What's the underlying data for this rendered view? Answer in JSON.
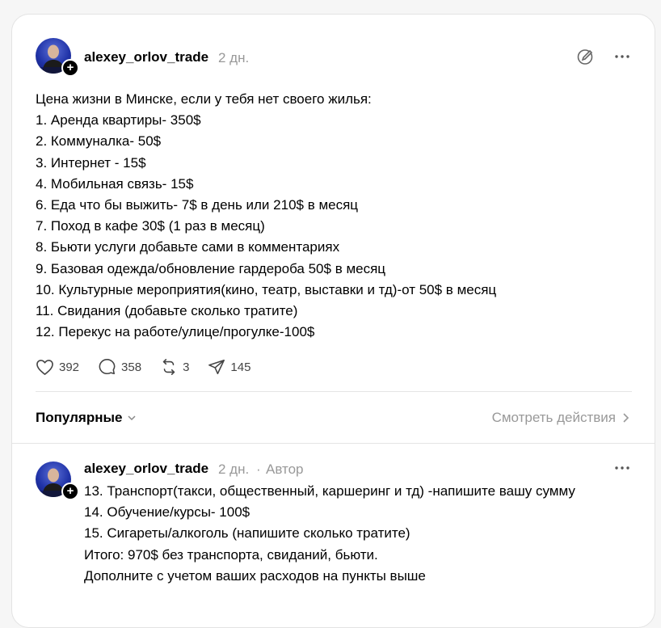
{
  "post": {
    "username": "alexey_orlov_trade",
    "time": "2 дн.",
    "lines": [
      "Цена жизни в Минске, если у тебя нет своего жилья:",
      "1. Аренда квартиры- 350$",
      "2. Коммуналка- 50$",
      "3. Интернет - 15$",
      "4. Мобильная связь- 15$",
      "6. Еда что бы выжить- 7$ в день или 210$ в месяц",
      "7. Поход в кафе 30$ (1 раз в месяц)",
      "8. Бьюти услуги добавьте сами в комментариях",
      "9. Базовая одежда/обновление гардероба 50$ в месяц",
      "10. Культурные мероприятия(кино, театр, выставки и тд)-от 50$ в месяц",
      "11. Свидания (добавьте сколько тратите)",
      "12. Перекус на работе/улице/прогулке-100$"
    ],
    "likes": "392",
    "replies": "358",
    "reposts": "3",
    "shares": "145"
  },
  "sort": {
    "label": "Популярные",
    "view_activity": "Смотреть действия"
  },
  "reply": {
    "username": "alexey_orlov_trade",
    "time": "2 дн.",
    "dot": "·",
    "author_badge": "Автор",
    "lines": [
      "13. Транспорт(такси, общественный, каршеринг и тд) -напишите вашу сумму",
      "14. Обучение/курсы- 100$",
      "15. Сигареты/алкоголь (напишите сколько тратите)",
      "Итого: 970$ без транспорта, свиданий, бьюти.",
      "Дополните с учетом ваших расходов на пункты выше"
    ]
  }
}
